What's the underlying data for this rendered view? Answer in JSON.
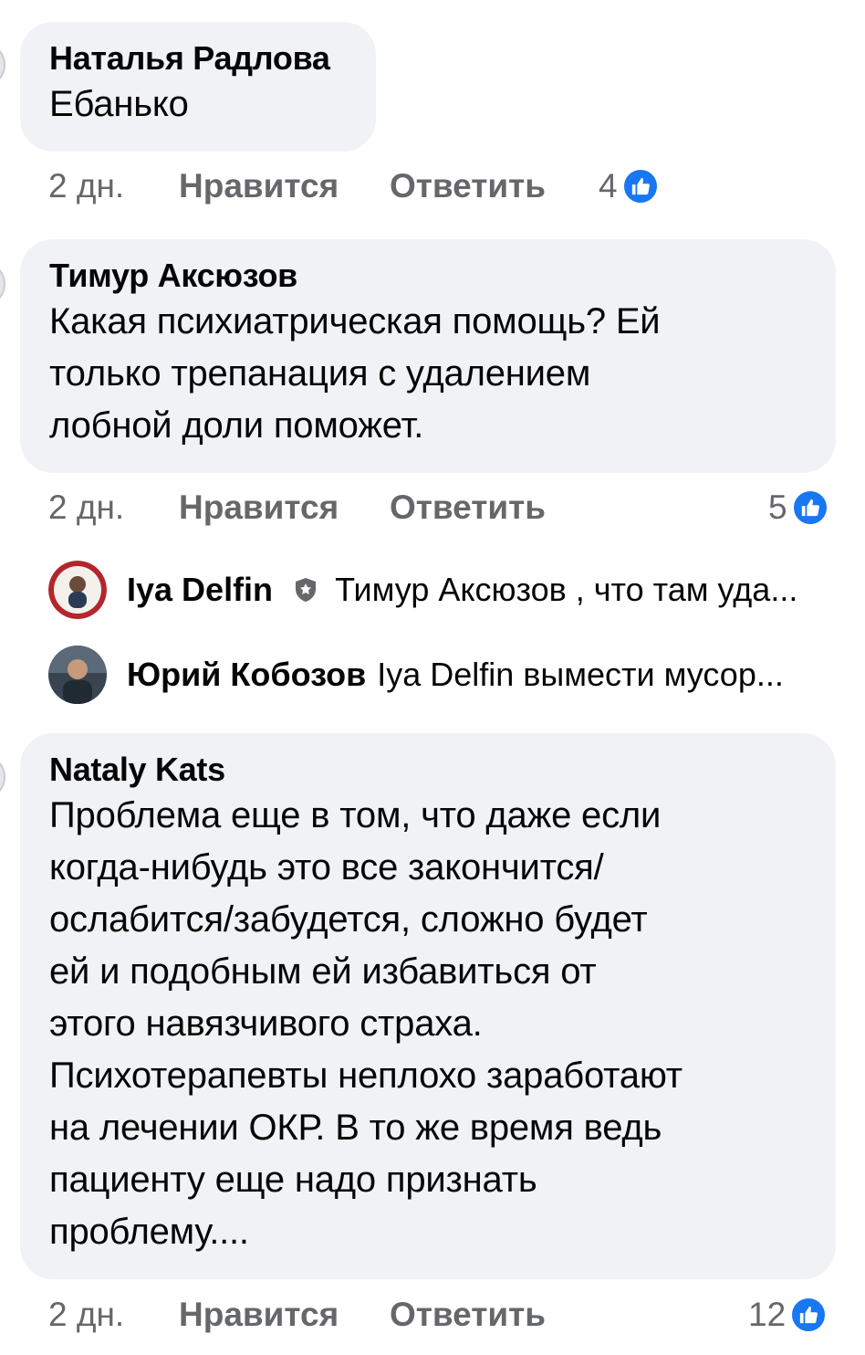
{
  "comments": [
    {
      "author": "Наталья Радлова",
      "lines": [
        "Ебанько"
      ],
      "time": "2 дн.",
      "like_label": "Нравится",
      "reply_label": "Ответить",
      "reactions": "4",
      "reaction_icon": "like-icon"
    },
    {
      "author": "Тимур Аксюзов",
      "lines": [
        "Какая психиатрическая помощь? Ей",
        "только трепанация с удалением",
        "лобной доли поможет."
      ],
      "time": "2 дн.",
      "like_label": "Нравится",
      "reply_label": "Ответить",
      "reactions": "5",
      "reaction_icon": "like-icon"
    },
    {
      "author": "Nataly Kats",
      "lines": [
        "Проблема еще в том, что даже если",
        "когда-нибудь это все закончится/",
        "ослабится/забудется, сложно будет",
        "ей и подобным ей избавиться от",
        "этого навязчивого страха.",
        "Психотерапевты неплохо заработают",
        "на лечении ОКР. В то же время ведь",
        "пациенту еще надо признать",
        "проблему...."
      ],
      "time": "2 дн.",
      "like_label": "Нравится",
      "reply_label": "Ответить",
      "reactions": "12",
      "reaction_icon": "like-icon"
    }
  ],
  "replies": [
    {
      "name": "Iya Delfin",
      "badge_icon": "shield-badge-icon",
      "snippet": "Тимур Аксюзов , что там уда..."
    },
    {
      "name": "Юрий Кобозов",
      "snippet": "Iya Delfin вымести мусор..."
    }
  ],
  "colors": {
    "bubble": "#f0f2f5",
    "meta_text": "#65676b",
    "like_blue": "#1877f2"
  }
}
